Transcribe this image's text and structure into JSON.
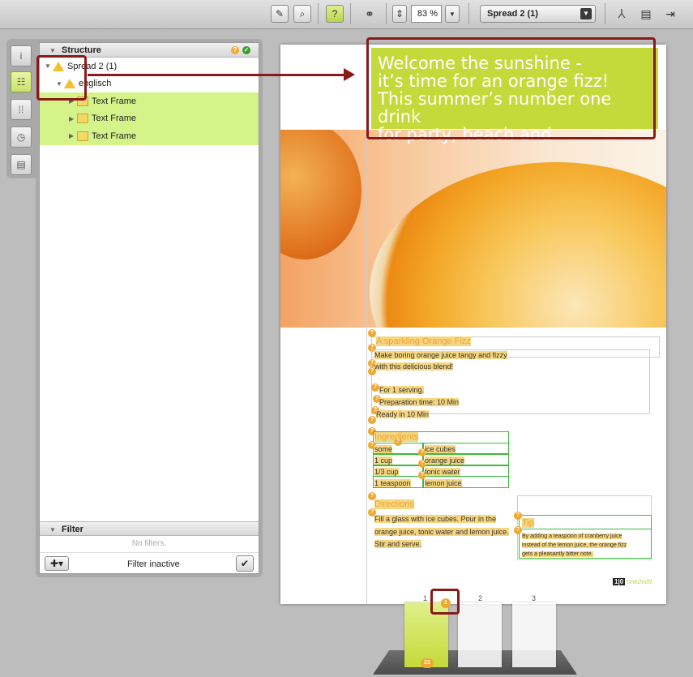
{
  "toolbar": {
    "zoom_value": "83 %",
    "spread_select": "Spread 2 (1)",
    "icons": [
      "pencil-icon",
      "magnifier-icon",
      "help-icon",
      "binoculars-icon",
      "stepper-icon",
      "pdf-icon",
      "save-icon",
      "exit-icon"
    ]
  },
  "sidetools": [
    "info-icon",
    "structure-icon",
    "layout-icon",
    "history-icon",
    "comment-icon"
  ],
  "structure": {
    "title": "Structure",
    "tree": [
      {
        "label": "Spread 2 (1)",
        "level": 0,
        "icon": "warning-icon"
      },
      {
        "label": "englisch",
        "level": 1,
        "icon": "layer-warning-icon"
      },
      {
        "label": "Text Frame",
        "level": 2,
        "icon": "text-frame-icon"
      },
      {
        "label": "Text Frame",
        "level": 2,
        "icon": "text-frame-icon"
      },
      {
        "label": "Text Frame",
        "level": 2,
        "icon": "text-frame-icon"
      }
    ]
  },
  "filter": {
    "title": "Filter",
    "empty": "No filters.",
    "state": "Filter inactive"
  },
  "page": {
    "hero_line1": "Welcome the sunshine -",
    "hero_line2": "it’s time for an orange fizz!",
    "hero_line3": "This summer’s number one drink",
    "hero_line4": "for party, beach and",
    "recipe_title": "A sparkling Orange Fizz",
    "intro1": "Make boring orange juice tangy and fizzy",
    "intro2": "with this delicious blend!",
    "serving": "For 1 serving.",
    "prep": "Preparation time: 10 Min",
    "ready": "Ready in 10 Min",
    "ingredients_title": "Ingredients",
    "ingredients": [
      {
        "qty": "some",
        "item": "ice cubes"
      },
      {
        "qty": "1 cup",
        "item": "orange juice"
      },
      {
        "qty": "1/3 cup",
        "item": "tonic water"
      },
      {
        "qty": "1 teaspoon",
        "item": "lemon juice"
      }
    ],
    "directions_title": "Directions",
    "dir1": "Fill a glass with ice cubes. Pour in the",
    "dir2": "orange juice, tonic water and lemon juice.",
    "dir3": "Stir and serve.",
    "tip_title": "Tip",
    "tip1": "By adding a teaspoon of cranberry juice",
    "tip2": "instead of the lemon juice, the orange fizz",
    "tip3": "gets a pleasantly bitter note.",
    "logo_mark": "1|0",
    "logo_text": "one2edit"
  },
  "pages_strip": {
    "numbers": [
      "1",
      "2",
      "3"
    ],
    "warning_badge": "1",
    "count_badge": "21"
  },
  "colors": {
    "accent_green": "#c4da3a",
    "highlight_green": "#d4f389",
    "annotation_red": "#8a1a1a",
    "warning_orange": "#f0a830"
  }
}
